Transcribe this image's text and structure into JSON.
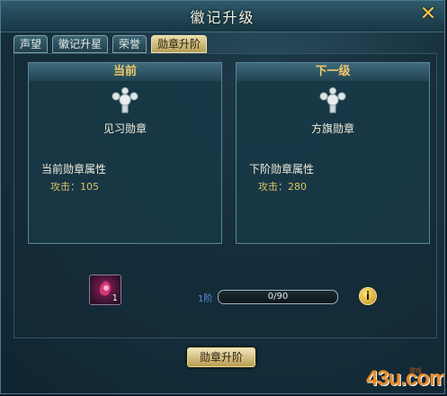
{
  "window": {
    "title": "徽记升级",
    "close_glyph": "✕"
  },
  "tabs": [
    {
      "label": "声望",
      "active": false
    },
    {
      "label": "徽记升星",
      "active": false
    },
    {
      "label": "荣誉",
      "active": false
    },
    {
      "label": "勋章升阶",
      "active": true
    }
  ],
  "current": {
    "heading": "当前",
    "medal_name": "见习勋章",
    "attr_title": "当前勋章属性",
    "attr_label": "攻击：",
    "attr_value": "105"
  },
  "next": {
    "heading": "下一级",
    "medal_name": "方旗勋章",
    "attr_title": "下阶勋章属性",
    "attr_label": "攻击：",
    "attr_value": "280"
  },
  "item": {
    "count": "1",
    "icon": "medal-gem-icon"
  },
  "progress": {
    "tier_label": "1阶",
    "text": "0/90",
    "fraction": 0
  },
  "info_glyph": "i",
  "upgrade_button": "勋章升阶",
  "watermark": {
    "main": "43u.com",
    "sub": "游戏"
  }
}
